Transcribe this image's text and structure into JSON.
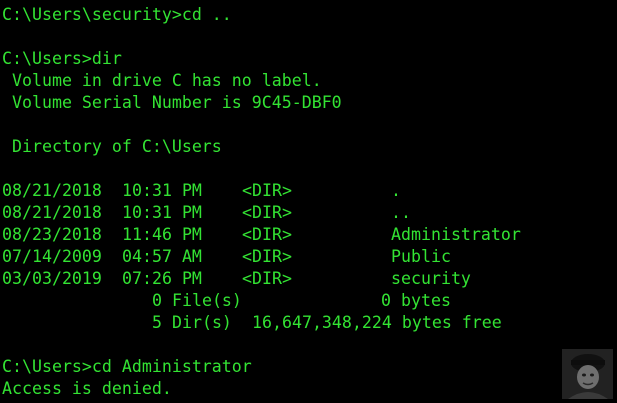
{
  "colors": {
    "background": "#000000",
    "text": "#33e333"
  },
  "terminal": {
    "cd_up_cmd": "C:\\Users\\security>cd ..",
    "dir_cmd": "C:\\Users>dir",
    "volume_label": " Volume in drive C has no label.",
    "volume_serial": " Volume Serial Number is 9C45-DBF0",
    "directory_of": " Directory of C:\\Users",
    "entries": [
      {
        "date": "08/21/2018",
        "time": "10:31 PM",
        "type": "<DIR>",
        "name": "."
      },
      {
        "date": "08/21/2018",
        "time": "10:31 PM",
        "type": "<DIR>",
        "name": ".."
      },
      {
        "date": "08/23/2018",
        "time": "11:46 PM",
        "type": "<DIR>",
        "name": "Administrator"
      },
      {
        "date": "07/14/2009",
        "time": "04:57 AM",
        "type": "<DIR>",
        "name": "Public"
      },
      {
        "date": "03/03/2019",
        "time": "07:26 PM",
        "type": "<DIR>",
        "name": "security"
      }
    ],
    "files_summary": {
      "count": "0 File(s)",
      "size": "0 bytes"
    },
    "dirs_summary": {
      "count": "5 Dir(s)",
      "free": "16,647,348,224 bytes free"
    },
    "cd_admin_cmd": "C:\\Users>cd Administrator",
    "access_denied": "Access is denied."
  },
  "avatar": {
    "icon": "user-avatar-icon"
  }
}
